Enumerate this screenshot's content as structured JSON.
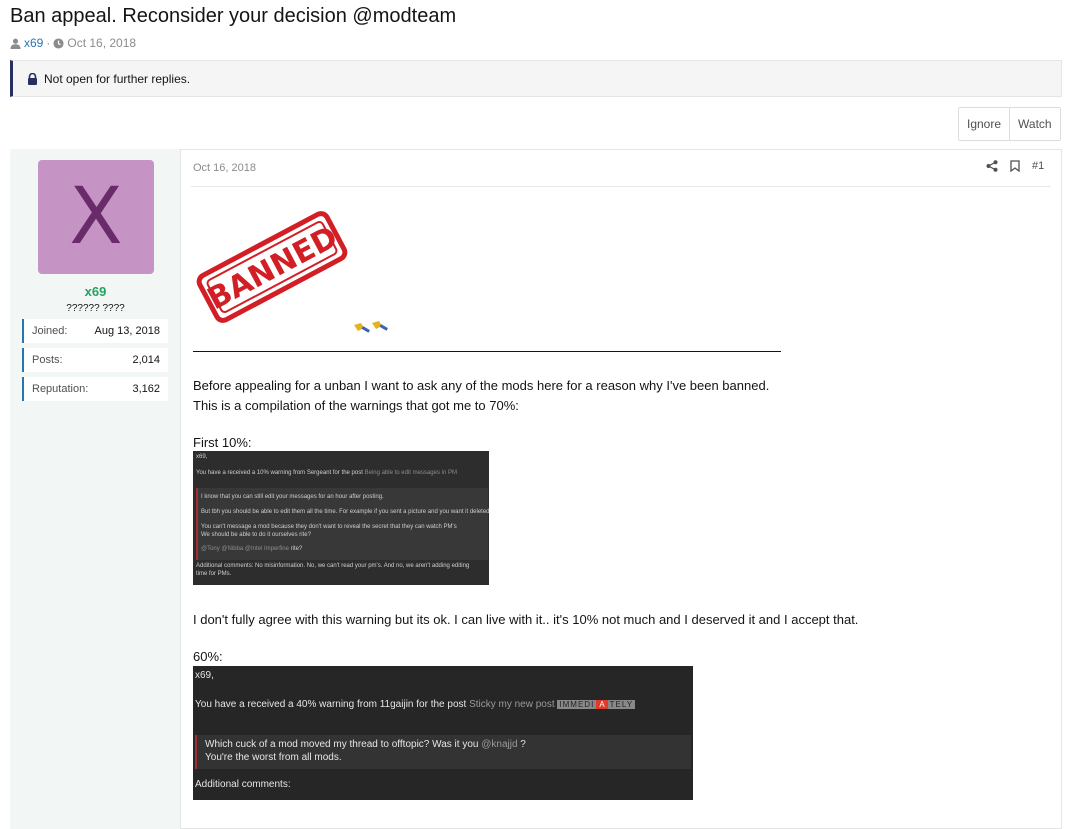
{
  "thread": {
    "title": "Ban appeal. Reconsider your decision @modteam",
    "author": "x69",
    "separator": "·",
    "date": "Oct 16, 2018",
    "notice": "Not open for further replies."
  },
  "actions": {
    "ignore_label": "Ignore",
    "watch_label": "Watch"
  },
  "user": {
    "avatar_letter": "X",
    "name": "x69",
    "title": "?????? ????",
    "stats": [
      {
        "key": "Joined:",
        "value": "Aug 13, 2018"
      },
      {
        "key": "Posts:",
        "value": "2,014"
      },
      {
        "key": "Reputation:",
        "value": "3,162"
      }
    ]
  },
  "post": {
    "date": "Oct 16, 2018",
    "number": "#1",
    "stamp_text": "BANNED",
    "para1_line1": "Before appealing for a unban I want to ask any of the mods here for a reason why I've been banned.",
    "para1_line2": "This is a compilation of the warnings that got me to 70%:",
    "first_label": "First 10%:",
    "para2": "I don't fully agree with this warning but its ok. I can live with it.. it's 10% not much and I deserved it and I accept that.",
    "sixty_label": "60%:"
  },
  "screenshot1": {
    "l1": "x69,",
    "l2a": "You have a received a 10% warning from Sergeant for the post ",
    "l2b": "Being able to edit messages in PM",
    "q1": "I know that you can still edit your messages for an hour after posting.",
    "q2": "But tbh you should be able to edit them all the time. For example if you sent a picture and you want it deleted",
    "q3": "You can't message a mod because they don't want to reveal the secret that they can watch PM's",
    "q4": "We should be able to do it ourselves rite?",
    "q5a": "@Tony @Nibba @Intel Imperfine ",
    "q5b": "rite?",
    "c1": "Additional comments: No misinformation. No, we can't read your pm's. And no, we aren't adding editing",
    "c2": "time for PMs."
  },
  "screenshot2": {
    "l1": "x69,",
    "l2a": "You have a received a 40% warning from 11gaijin for the post ",
    "l2b": "Sticky my new post ",
    "tag1": "IMMEDI",
    "tag2": "A",
    "tag3": "TELY",
    "q1": "Which cuck of a mod moved my thread to offtopic? Was it you ",
    "q1b": "@knajjd",
    "q1c": " ?",
    "q2": "You're the worst from all mods.",
    "c1": "Additional comments:"
  },
  "colors": {
    "link": "#2577b1",
    "username": "#21a361",
    "avatar_bg": "#c594c5",
    "stamp": "#d21f26"
  }
}
